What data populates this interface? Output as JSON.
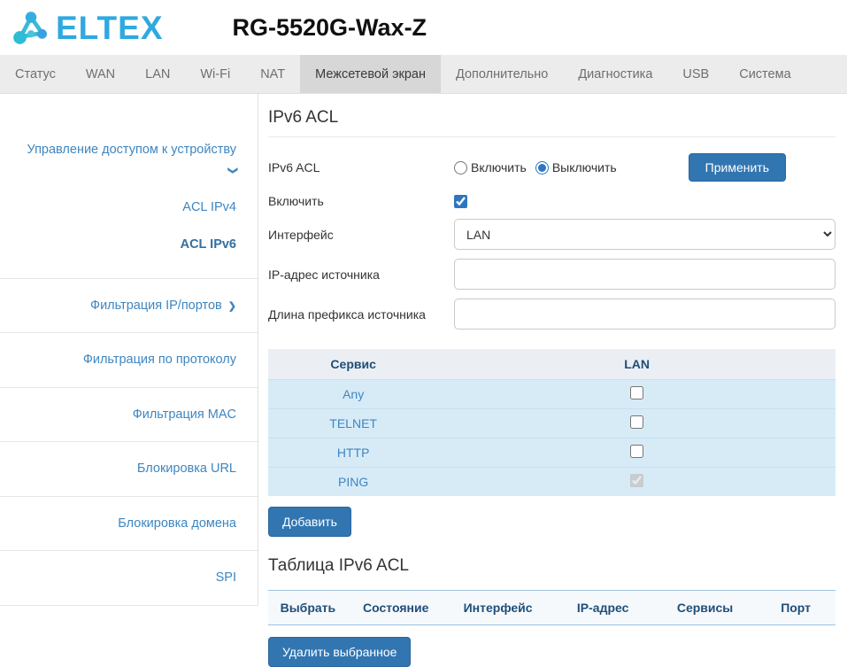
{
  "colors": {
    "accent": "#3276b1",
    "brand": "#2fa9e0",
    "table_row": "#d7ebf7",
    "header_text": "#1f4e79"
  },
  "header": {
    "brand": "ELTEX",
    "title": "RG-5520G-Wax-Z"
  },
  "nav": {
    "tabs": [
      {
        "label": "Статус",
        "active": false
      },
      {
        "label": "WAN",
        "active": false
      },
      {
        "label": "LAN",
        "active": false
      },
      {
        "label": "Wi-Fi",
        "active": false
      },
      {
        "label": "NAT",
        "active": false
      },
      {
        "label": "Межсетевой экран",
        "active": true
      },
      {
        "label": "Дополнительно",
        "active": false
      },
      {
        "label": "Диагностика",
        "active": false
      },
      {
        "label": "USB",
        "active": false
      },
      {
        "label": "Система",
        "active": false
      }
    ]
  },
  "sidebar": {
    "items": [
      {
        "label": "Управление доступом к устройству",
        "chevron": "down",
        "active": false
      },
      {
        "label": "ACL IPv4",
        "active": false
      },
      {
        "label": "ACL IPv6",
        "active": true
      },
      {
        "label": "Фильтрация IP/портов",
        "chevron": "right",
        "active": false
      },
      {
        "label": "Фильтрация по протоколу",
        "active": false
      },
      {
        "label": "Фильтрация MAC",
        "active": false
      },
      {
        "label": "Блокировка URL",
        "active": false
      },
      {
        "label": "Блокировка домена",
        "active": false
      },
      {
        "label": "SPI",
        "active": false
      }
    ]
  },
  "main": {
    "section_title": "IPv6 ACL",
    "form": {
      "acl_label": "IPv6 ACL",
      "radio_enable": "Включить",
      "radio_enable_checked": false,
      "radio_disable": "Выключить",
      "radio_disable_checked": true,
      "apply_button": "Применить",
      "enable_label": "Включить",
      "enable_checked": true,
      "interface_label": "Интерфейс",
      "interface_value": "LAN",
      "source_ip_label": "IP-адрес источника",
      "source_ip_value": "",
      "prefix_label": "Длина префикса источника",
      "prefix_value": ""
    },
    "service_table": {
      "headers": [
        "Сервис",
        "LAN"
      ],
      "rows": [
        {
          "service": "Any",
          "checked": false,
          "disabled": false
        },
        {
          "service": "TELNET",
          "checked": false,
          "disabled": false
        },
        {
          "service": "HTTP",
          "checked": false,
          "disabled": false
        },
        {
          "service": "PING",
          "checked": true,
          "disabled": true
        }
      ]
    },
    "add_button": "Добавить",
    "table_title": "Таблица IPv6 ACL",
    "acl_table": {
      "headers": [
        "Выбрать",
        "Состояние",
        "Интерфейс",
        "IP-адрес",
        "Сервисы",
        "Порт"
      ],
      "rows": []
    },
    "delete_button": "Удалить выбранное"
  }
}
